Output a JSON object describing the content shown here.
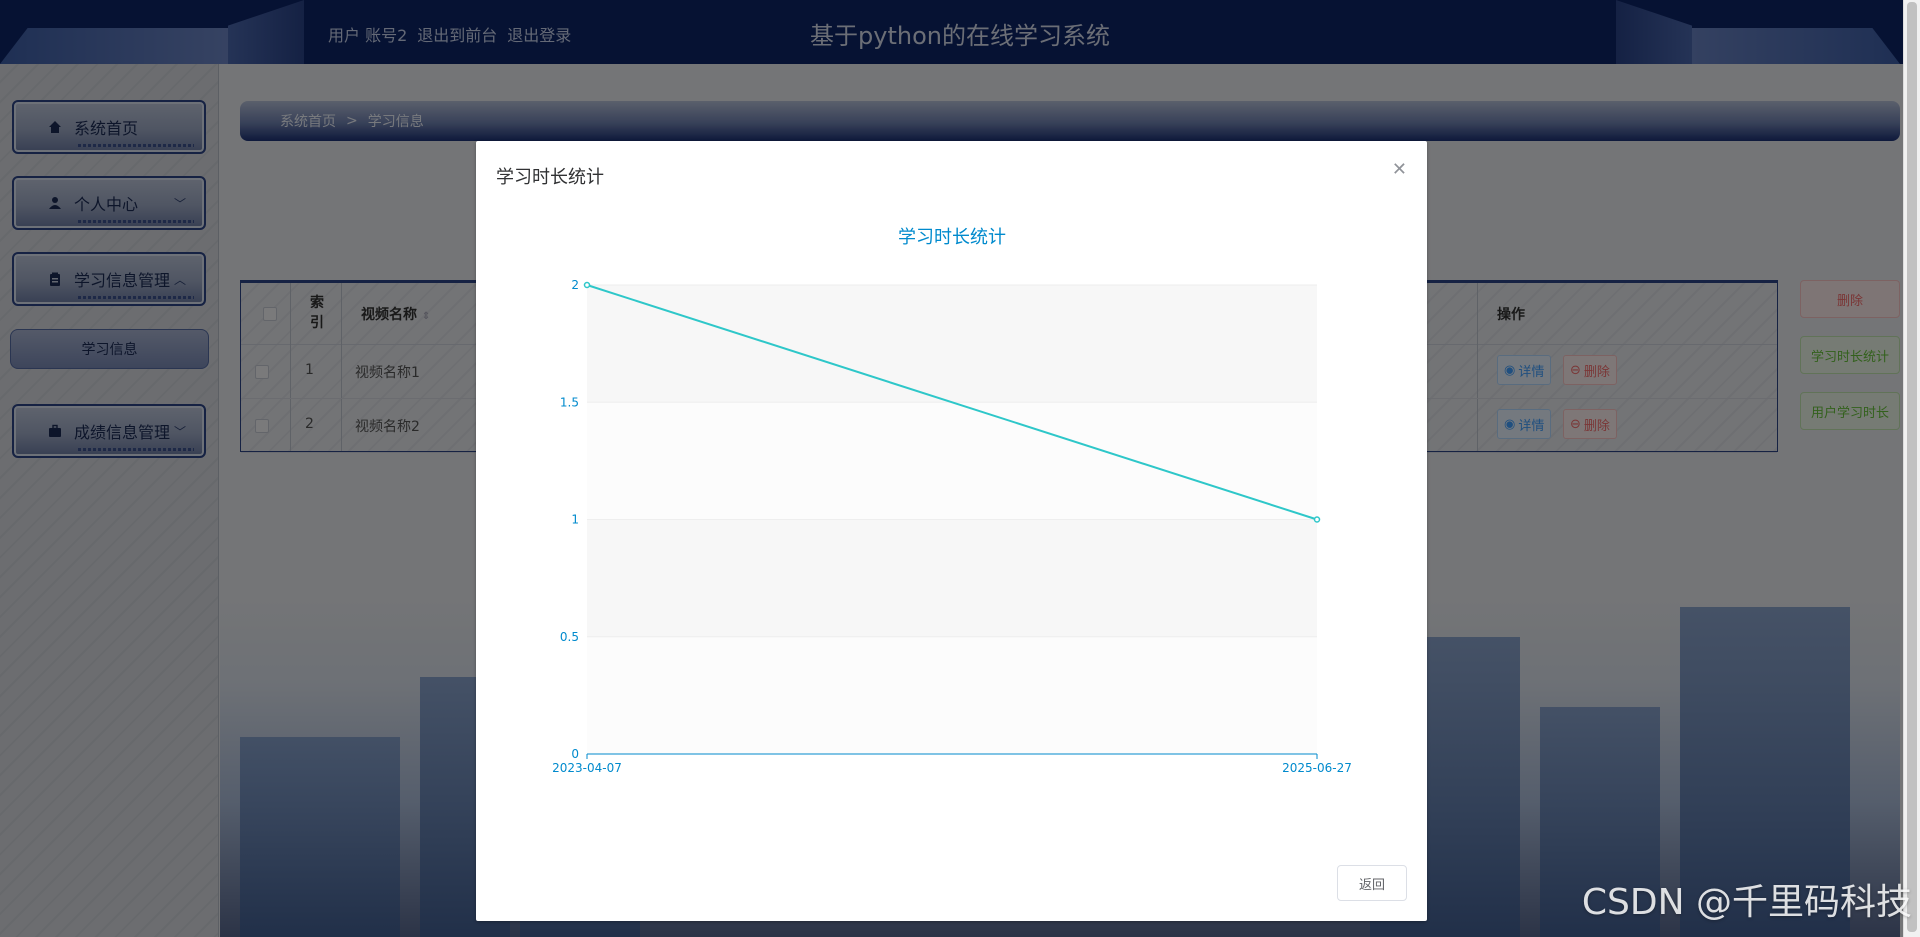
{
  "header": {
    "user_label": "用户 账号2",
    "back_to_front": "退出到前台",
    "logout": "退出登录",
    "site_title": "基于python的在线学习系统"
  },
  "sidebar": {
    "items": [
      {
        "label": "系统首页",
        "icon": "home-icon"
      },
      {
        "label": "个人中心",
        "icon": "user-icon",
        "chevron": "down"
      },
      {
        "label": "学习信息管理",
        "icon": "clipboard-icon",
        "chevron": "up"
      },
      {
        "label": "成绩信息管理",
        "icon": "briefcase-icon",
        "chevron": "down"
      }
    ],
    "sub_item": "学习信息"
  },
  "breadcrumb": {
    "home": "系统首页",
    "separator": ">",
    "current": "学习信息"
  },
  "table": {
    "headers": {
      "index": "索引",
      "video_name": "视频名称",
      "operation": "操作"
    },
    "rows": [
      {
        "index": "1",
        "video_name": "视频名称1"
      },
      {
        "index": "2",
        "video_name": "视频名称2"
      }
    ],
    "detail_label": "详情",
    "delete_label": "删除"
  },
  "side_buttons": {
    "delete": "删除",
    "study_stats": "学习时长统计",
    "user_study_time": "用户学习时长"
  },
  "modal": {
    "title": "学习时长统计",
    "return_label": "返回"
  },
  "chart_data": {
    "type": "line",
    "title": "学习时长统计",
    "x": [
      "2023-04-07",
      "2025-06-27"
    ],
    "series": [
      {
        "values": [
          2,
          1
        ]
      }
    ],
    "ylim": [
      0,
      2
    ],
    "yticks": [
      0,
      0.5,
      1,
      1.5,
      2
    ],
    "color": "#2ec7c9",
    "split_area": true
  },
  "watermark": "CSDN @千里码科技",
  "colors": {
    "accent": "#2ec7c9",
    "header": "#0d2466",
    "axis": "#008acd"
  }
}
